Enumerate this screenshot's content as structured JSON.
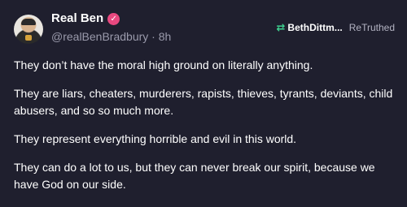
{
  "author": {
    "display_name": "Real Ben",
    "handle": "@realBenBradbury",
    "separator": "·",
    "time_ago": "8h",
    "verified_icon": "verified-check-icon",
    "verified_color": "#e8487f"
  },
  "retruth": {
    "icon": "retruth-arrows-icon",
    "icon_color": "#3ecf8e",
    "username": "BethDittm...",
    "label": "ReTruthed"
  },
  "post": {
    "paragraphs": [
      "They don’t have the moral high ground on literally anything.",
      "They are liars, cheaters, murderers, rapists, thieves, tyrants, deviants, child abusers, and so so much more.",
      "They represent everything horrible and evil in this world.",
      "They can do a lot to us, but they can never break our spirit, because we have God on our side."
    ]
  }
}
